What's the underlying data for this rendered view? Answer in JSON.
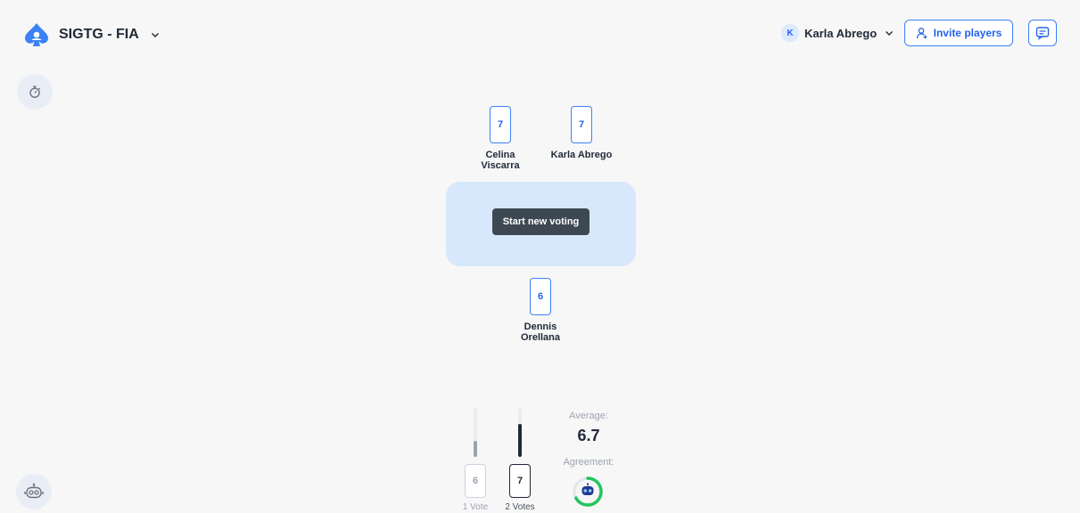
{
  "header": {
    "room_name": "SIGTG - FIA",
    "user_initial": "K",
    "user_name": "Karla Abrego",
    "invite_label": "Invite players"
  },
  "icons": {
    "logo": "spade-logo-icon",
    "timer": "stopwatch-icon",
    "bot": "robot-icon",
    "chat": "chat-icon",
    "invite": "add-user-icon"
  },
  "players": [
    {
      "name": "Celina Viscarra",
      "vote": "7"
    },
    {
      "name": "Karla Abrego",
      "vote": "7"
    },
    {
      "name": "Dennis Orellana",
      "vote": "6"
    }
  ],
  "table": {
    "action_label": "Start new voting"
  },
  "results": {
    "votes": [
      {
        "value": "6",
        "count_label": "1 Vote",
        "count": 1
      },
      {
        "value": "7",
        "count_label": "2 Votes",
        "count": 2
      }
    ],
    "max_count": 3,
    "average_label": "Average:",
    "average_value": "6.7",
    "agreement_label": "Agreement:",
    "agreement_fraction": 0.67
  },
  "colors": {
    "accent": "#3b82f6",
    "table": "#d8e8fc",
    "agreement": "#22c55e"
  }
}
